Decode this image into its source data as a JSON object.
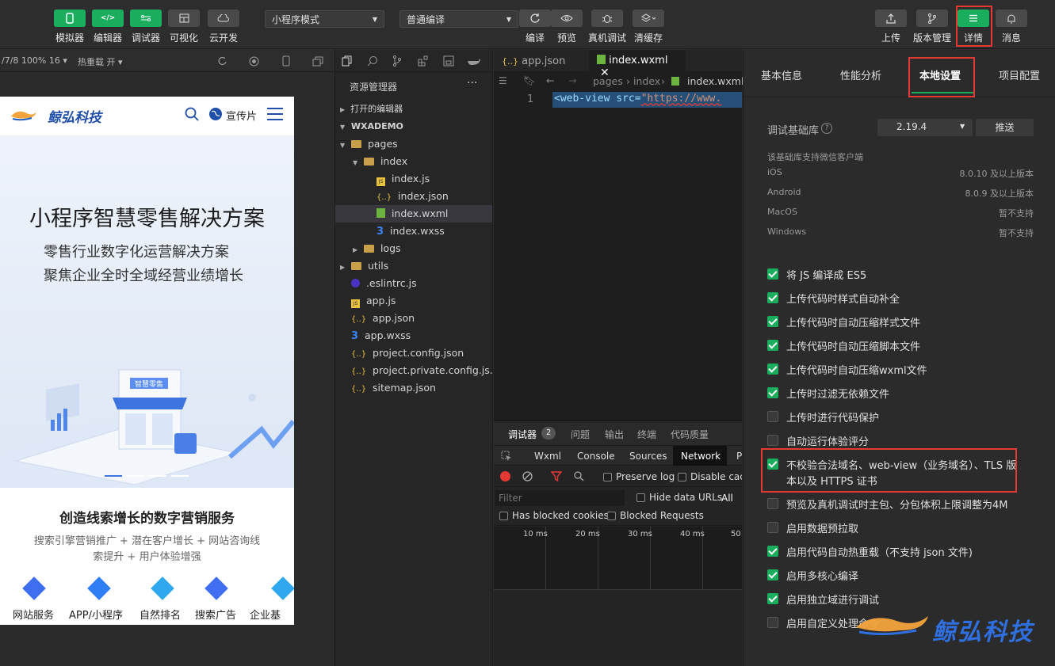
{
  "toolbar": {
    "left_buttons": [
      {
        "label": "模拟器",
        "icon": "phone-icon"
      },
      {
        "label": "编辑器",
        "icon": "code-icon"
      },
      {
        "label": "调试器",
        "icon": "debug-toggle-icon"
      },
      {
        "label": "可视化",
        "icon": "layout-icon"
      },
      {
        "label": "云开发",
        "icon": "cloud-icon"
      }
    ],
    "mode_select": "小程序模式",
    "compile_select": "普通编译",
    "mid_buttons": [
      {
        "label": "编译",
        "icon": "refresh-icon"
      },
      {
        "label": "预览",
        "icon": "eye-icon"
      },
      {
        "label": "真机调试",
        "icon": "bug-icon"
      },
      {
        "label": "清缓存",
        "icon": "layers-icon"
      }
    ],
    "right_buttons": [
      {
        "label": "上传",
        "icon": "upload-icon"
      },
      {
        "label": "版本管理",
        "icon": "branch-icon"
      },
      {
        "label": "详情",
        "icon": "menu-icon"
      },
      {
        "label": "消息",
        "icon": "bell-icon"
      }
    ]
  },
  "simulator": {
    "device_info": "/7/8 100% 16 ▾",
    "hot_reload": "热重载 开 ▾",
    "page": {
      "brand": "鲸弘科技",
      "promo_label": "宣传片",
      "hero_title": "小程序智慧零售解决方案",
      "hero_line1": "零售行业数字化运营解决方案",
      "hero_line2": "聚焦企业全时全域经营业绩增长",
      "store_sign": "智慧零售",
      "section_title": "创造线索增长的数字营销服务",
      "section_desc1": "搜索引擎营销推广 + 潜在客户增长 + 网站咨询线",
      "section_desc2": "索提升 + 用户体验增强",
      "services": [
        "网站服务",
        "APP/小程序",
        "自然排名",
        "搜索广告",
        "企业基"
      ]
    }
  },
  "explorer": {
    "title": "资源管理器",
    "open_editors": "打开的编辑器",
    "project": "WXADEMO",
    "items": [
      {
        "label": "pages",
        "type": "folder-open",
        "indent": 1
      },
      {
        "label": "index",
        "type": "folder-open",
        "indent": 2
      },
      {
        "label": "index.js",
        "type": "js",
        "indent": 3
      },
      {
        "label": "index.json",
        "type": "json",
        "indent": 3
      },
      {
        "label": "index.wxml",
        "type": "wxml",
        "indent": 3
      },
      {
        "label": "index.wxss",
        "type": "wxss",
        "indent": 3
      },
      {
        "label": "logs",
        "type": "folder",
        "indent": 2
      },
      {
        "label": "utils",
        "type": "folder",
        "indent": 1
      },
      {
        "label": ".eslintrc.js",
        "type": "eslint",
        "indent": 1
      },
      {
        "label": "app.js",
        "type": "js",
        "indent": 1
      },
      {
        "label": "app.json",
        "type": "json",
        "indent": 1
      },
      {
        "label": "app.wxss",
        "type": "wxss",
        "indent": 1
      },
      {
        "label": "project.config.json",
        "type": "json",
        "indent": 1
      },
      {
        "label": "project.private.config.js...",
        "type": "json",
        "indent": 1
      },
      {
        "label": "sitemap.json",
        "type": "json",
        "indent": 1
      }
    ]
  },
  "editor": {
    "tabs": [
      {
        "label": "app.json"
      },
      {
        "label": "index.wxml",
        "active": true
      }
    ],
    "breadcrumb": [
      "pages",
      "index",
      "index.wxml"
    ],
    "line_number": "1",
    "code_tag": "<web-view src=",
    "code_string": "\"https://www."
  },
  "devtools": {
    "tabs": [
      "调试器",
      "问题",
      "输出",
      "终端",
      "代码质量"
    ],
    "badge": "2",
    "subtabs": [
      "Wxml",
      "Console",
      "Sources",
      "Network",
      "P"
    ],
    "preserve_log": "Preserve log",
    "disable_cache": "Disable cach",
    "filter_placeholder": "Filter",
    "hide_data_urls": "Hide data URLs",
    "all_label": "All",
    "has_blocked_cookies": "Has blocked cookies",
    "blocked_requests": "Blocked Requests",
    "timeline": [
      "10 ms",
      "20 ms",
      "30 ms",
      "40 ms",
      "50"
    ]
  },
  "details": {
    "tabs": [
      "基本信息",
      "性能分析",
      "本地设置",
      "项目配置"
    ],
    "active_tab": "本地设置",
    "lib_label": "调试基础库",
    "lib_version": "2.19.4",
    "push_button": "推送",
    "support_title": "该基础库支持微信客户端",
    "platforms": [
      {
        "name": "iOS",
        "value": "8.0.10 及以上版本"
      },
      {
        "name": "Android",
        "value": "8.0.9 及以上版本"
      },
      {
        "name": "MacOS",
        "value": "暂不支持"
      },
      {
        "name": "Windows",
        "value": "暂不支持"
      }
    ],
    "options": [
      {
        "label": "将 JS 编译成 ES5",
        "checked": true
      },
      {
        "label": "上传代码时样式自动补全",
        "checked": true
      },
      {
        "label": "上传代码时自动压缩样式文件",
        "checked": true
      },
      {
        "label": "上传代码时自动压缩脚本文件",
        "checked": true
      },
      {
        "label": "上传代码时自动压缩wxml文件",
        "checked": true
      },
      {
        "label": "上传时过滤无依赖文件",
        "checked": true
      },
      {
        "label": "上传时进行代码保护",
        "checked": false
      },
      {
        "label": "自动运行体验评分",
        "checked": false
      },
      {
        "label": "不校验合法域名、web-view（业务域名）、TLS 版",
        "label2": "本以及 HTTPS 证书",
        "checked": true
      },
      {
        "label": "预览及真机调试时主包、分包体积上限调整为4M",
        "checked": false
      },
      {
        "label": "启用数据预拉取",
        "checked": false
      },
      {
        "label": "启用代码自动热重载（不支持 json 文件)",
        "checked": true
      },
      {
        "label": "启用多核心编译",
        "checked": true
      },
      {
        "label": "启用独立域进行调试",
        "checked": true
      },
      {
        "label": "启用自定义处理命令",
        "checked": false
      }
    ],
    "watermark": "鲸弘科技"
  }
}
